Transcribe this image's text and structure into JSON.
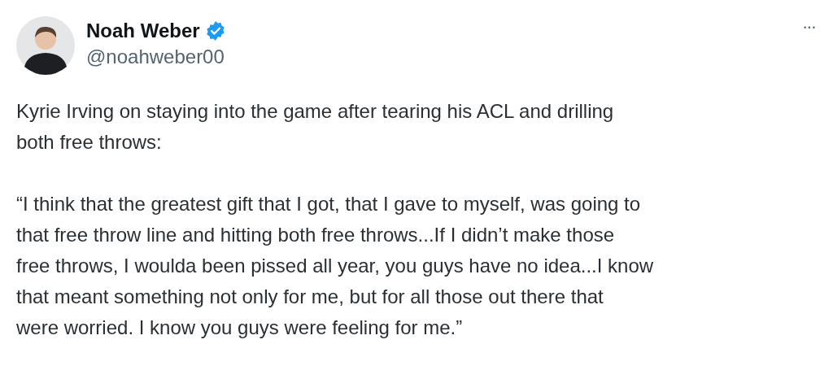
{
  "author": {
    "name": "Noah Weber",
    "verified": true,
    "handle": "@noahweber00"
  },
  "more_button": "···",
  "paragraphs": [
    {
      "lines": [
        "Kyrie Irving on staying into the game after tearing his ACL and drilling",
        "both free throws:"
      ]
    },
    {
      "lines": [
        "“I think that the greatest gift that I got, that I gave to myself, was going to",
        "that free throw line and hitting both free throws...If I didn’t make those",
        "free throws, I woulda been pissed all year, you guys have no idea...I know",
        "that meant something not only for me, but for all those out there that",
        "were worried. I know you guys were feeling for me.”"
      ]
    }
  ]
}
